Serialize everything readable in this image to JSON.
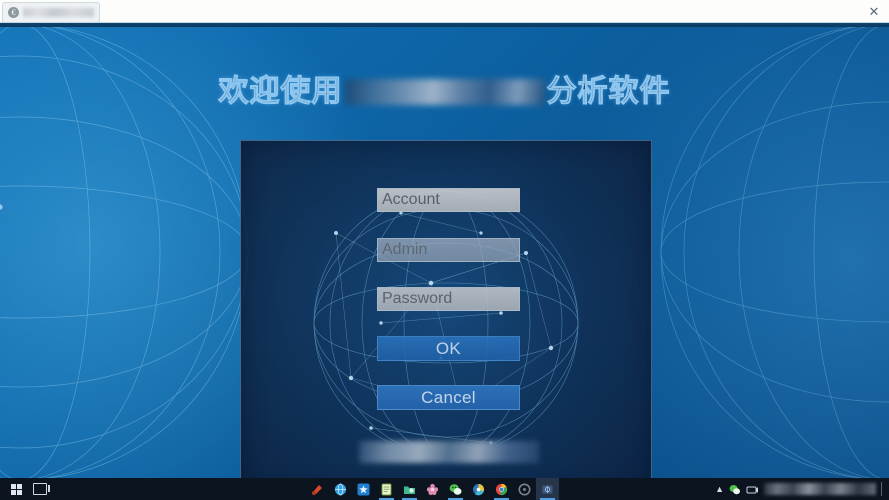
{
  "window": {
    "tab_title_redacted": "",
    "tab_icon": "app-icon",
    "close_label": "✕"
  },
  "banner": {
    "prefix": "欢迎使用",
    "redacted_middle": "",
    "suffix": "分析软件"
  },
  "dialog": {
    "fields": [
      {
        "name": "account",
        "value": "Account"
      },
      {
        "name": "admin",
        "value": "Admin"
      },
      {
        "name": "password",
        "value": "Password"
      }
    ],
    "buttons": [
      {
        "name": "ok",
        "label": "OK"
      },
      {
        "name": "cancel",
        "label": "Cancel"
      }
    ],
    "footer_redacted": ""
  },
  "taskbar": {
    "start_label": "start-button",
    "task_view_label": "task-view-button",
    "apps": [
      {
        "name": "media-player",
        "color": "#d94a2b"
      },
      {
        "name": "internet-explorer",
        "color": "#2e9fe0"
      },
      {
        "name": "blue-star-app",
        "color": "#1f7fd0"
      },
      {
        "name": "notepad",
        "color": "#8fc740"
      },
      {
        "name": "green-folder-app",
        "color": "#43b88c"
      },
      {
        "name": "pink-flower-app",
        "color": "#e28ab0"
      },
      {
        "name": "wechat",
        "color": "#4ec04e"
      },
      {
        "name": "colorful-circle-app",
        "color": "#3fb6d8"
      },
      {
        "name": "chrome",
        "color": "#e8453c"
      },
      {
        "name": "gray-disc-app",
        "color": "#7a828c"
      },
      {
        "name": "active-app",
        "color": "#3c5a80"
      }
    ],
    "tray_text_redacted": ""
  },
  "colors": {
    "desktop_blue": "#0d66a8",
    "dialog_navy": "#10284a",
    "button_blue": "#2c70b8",
    "field_gray": "#bec4ca",
    "title_stroke": "#96cdf5"
  }
}
